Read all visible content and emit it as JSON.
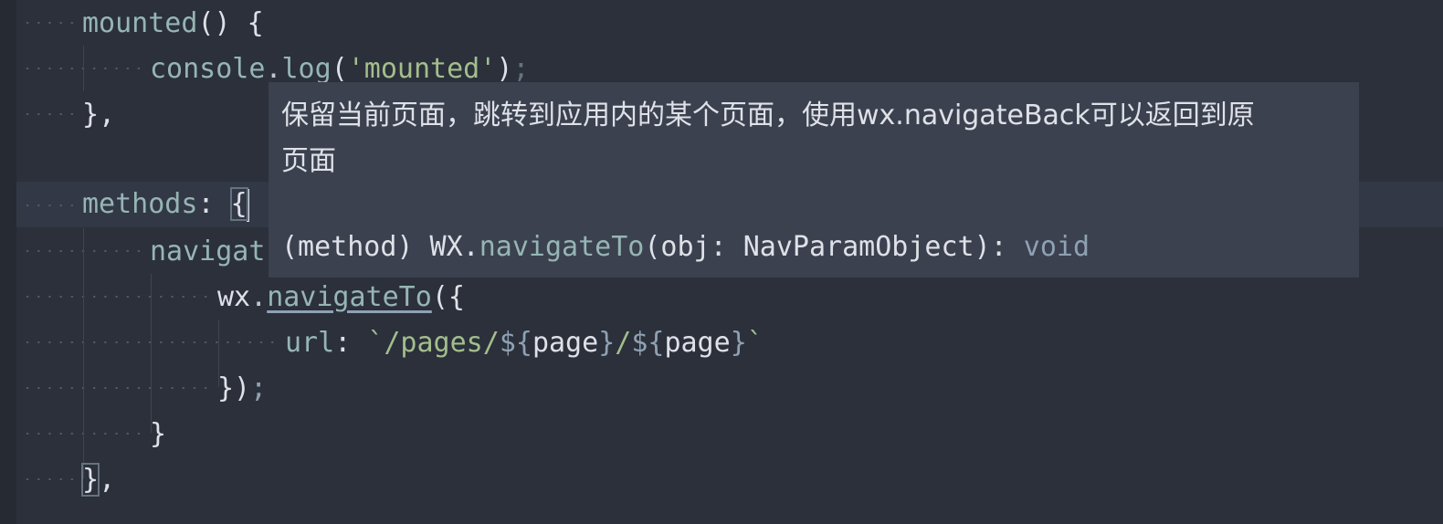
{
  "editor": {
    "lines": [
      {
        "id": "mounted",
        "tokens": [
          "mounted",
          "() {"
        ]
      },
      {
        "id": "console",
        "tokens": [
          "console",
          ".",
          "log",
          "(",
          "'mounted'",
          ")",
          ";"
        ]
      },
      {
        "id": "close1",
        "tokens": [
          "},"
        ]
      },
      {
        "id": "methods",
        "tokens": [
          "methods",
          ": ",
          "{"
        ]
      },
      {
        "id": "navigate",
        "tokens": [
          "navigat"
        ]
      },
      {
        "id": "wx",
        "tokens": [
          "wx",
          ".",
          "navigateTo",
          "({"
        ]
      },
      {
        "id": "url",
        "tokens": [
          "url",
          ": ",
          "`/pages/",
          "${",
          "page",
          "}",
          "/",
          "${",
          "page",
          "}",
          "`"
        ]
      },
      {
        "id": "close2",
        "tokens": [
          "})",
          ";"
        ]
      },
      {
        "id": "close3",
        "tokens": [
          "}"
        ]
      },
      {
        "id": "close4",
        "tokens": [
          "}",
          ","
        ]
      }
    ]
  },
  "tooltip": {
    "doc_line1": "保留当前页面，跳转到应用内的某个页面，使用wx.navigateBack可以返回到原",
    "doc_line2": "页面",
    "sig_prefix": "(method) WX.",
    "sig_fn": "navigateTo",
    "sig_params": "(obj: NavParamObject): ",
    "sig_return": "void"
  },
  "colors": {
    "background": "#2b303b",
    "tooltip_bg": "#3b414f",
    "property": "#96b5b4",
    "string": "#a3be8c",
    "function": "#8fa1b3"
  }
}
